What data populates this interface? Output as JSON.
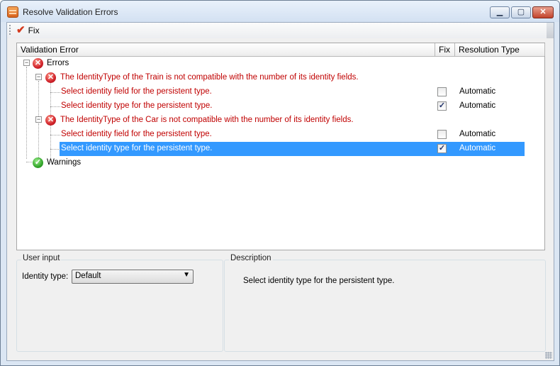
{
  "window": {
    "title": "Resolve Validation Errors"
  },
  "toolbar": {
    "fix_label": "Fix"
  },
  "grid": {
    "columns": {
      "validation_error": "Validation Error",
      "fix": "Fix",
      "resolution_type": "Resolution Type"
    },
    "rows": [
      {
        "text": "Errors",
        "kind": "group-errors"
      },
      {
        "text": "The IdentityType of the Train is not compatible with the number of its identity fields."
      },
      {
        "text": "Select identity field for the persistent type.",
        "fix": false,
        "resolution": "Automatic"
      },
      {
        "text": "Select identity type for the persistent type.",
        "fix": true,
        "resolution": "Automatic"
      },
      {
        "text": "The IdentityType of the Car is not compatible with the number of its identity fields."
      },
      {
        "text": "Select identity field for the persistent type.",
        "fix": false,
        "resolution": "Automatic"
      },
      {
        "text": "Select identity type for the persistent type.",
        "fix": true,
        "resolution": "Automatic",
        "selected": true
      },
      {
        "text": "Warnings",
        "kind": "group-warnings"
      }
    ]
  },
  "user_input": {
    "title": "User input",
    "identity_type_label": "Identity type:",
    "identity_type_value": "Default"
  },
  "description": {
    "title": "Description",
    "text": "Select identity type for the persistent type."
  },
  "colors": {
    "error_text": "#c00000",
    "selection": "#3399ff"
  }
}
